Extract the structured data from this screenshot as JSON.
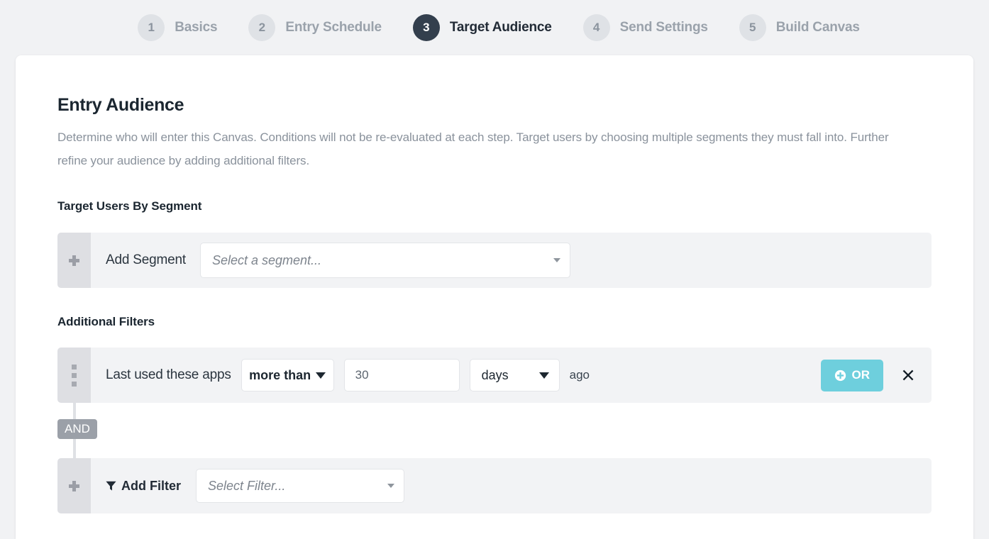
{
  "stepper": {
    "steps": [
      {
        "number": "1",
        "label": "Basics",
        "active": false
      },
      {
        "number": "2",
        "label": "Entry Schedule",
        "active": false
      },
      {
        "number": "3",
        "label": "Target Audience",
        "active": true
      },
      {
        "number": "4",
        "label": "Send Settings",
        "active": false
      },
      {
        "number": "5",
        "label": "Build Canvas",
        "active": false
      }
    ]
  },
  "page": {
    "title": "Entry Audience",
    "description": "Determine who will enter this Canvas. Conditions will not be re-evaluated at each step. Target users by choosing multiple segments they must fall into. Further refine your audience by adding additional filters."
  },
  "segment_section": {
    "title": "Target Users By Segment",
    "add_label": "Add Segment",
    "select_placeholder": "Select a segment...",
    "add_icon": "plus-icon",
    "caret_icon": "chevron-down-icon"
  },
  "filters_section": {
    "title": "Additional Filters",
    "connector_label": "AND",
    "filter_row": {
      "drag_handle_icon": "drag-handle-icon",
      "label": "Last used these apps",
      "operator": "more than",
      "value": "30",
      "unit": "days",
      "suffix": "ago",
      "or_button_label": "OR",
      "or_button_icon": "plus-circle-icon",
      "remove_icon": "close-icon"
    },
    "add_filter_row": {
      "add_icon": "plus-icon",
      "funnel_icon": "filter-funnel-icon",
      "label": "Add Filter",
      "select_placeholder": "Select Filter...",
      "caret_icon": "chevron-down-icon"
    }
  },
  "colors": {
    "page_background": "#f1f2f4",
    "card_background": "#ffffff",
    "active_step": "#333f4d",
    "inactive_step": "#dfe2e6",
    "row_background": "#f2f3f5",
    "handle_background": "#dedfe3",
    "or_accent": "#6ecfdd",
    "and_badge": "#9ba0a8"
  }
}
